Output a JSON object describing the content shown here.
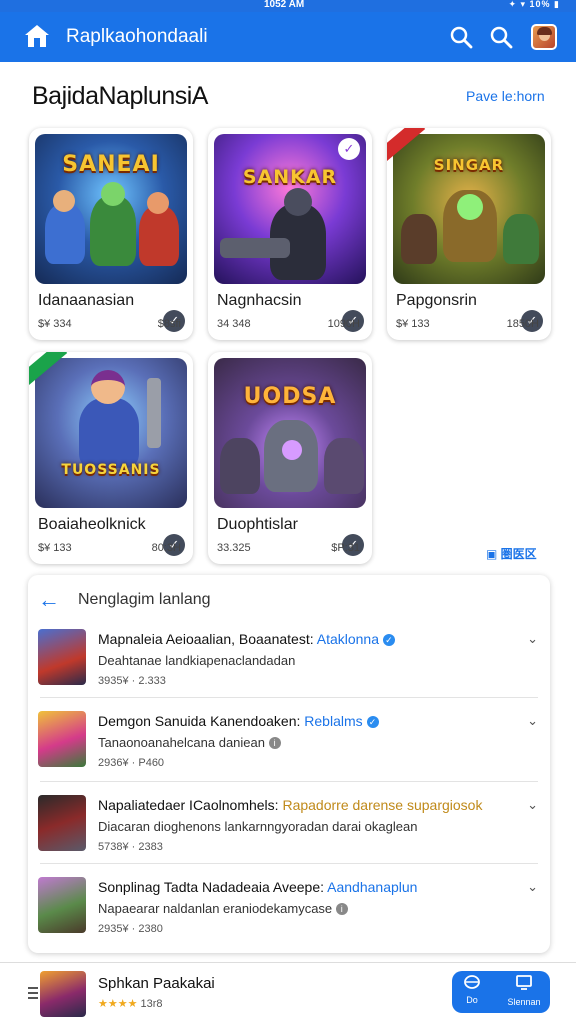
{
  "status_bar": {
    "time": "1052 AM",
    "icons": "✦ ▾ 10% ▮"
  },
  "app_bar": {
    "title": "Raplkaohondaali"
  },
  "featured": {
    "title": "BajidaNaplunsiA",
    "link": "Pave le:horn",
    "cards": [
      {
        "name": "Idanaanasian",
        "price": "$¥ 334",
        "size": "$8sfi",
        "logo": "SANEAI"
      },
      {
        "name": "Nagnhacsin",
        "price": "34 348",
        "size": "1090H",
        "logo": "SANKAR"
      },
      {
        "name": "Papgonsrin",
        "price": "$¥ 133",
        "size": "1850H",
        "logo": "SINGAR"
      },
      {
        "name": "Boaiaheolknick",
        "price": "$¥ 133",
        "size": "80:3H",
        "logo": "TUOSSANIS"
      },
      {
        "name": "Duophtislar",
        "price": "33.325",
        "size": "$P:31",
        "logo": "UODSA"
      }
    ],
    "view_more": "▣ 圏医区"
  },
  "list_panel": {
    "title": "Nenglagim lanlang",
    "items": [
      {
        "title": "Mapnaleia Aeioaalian, Boaanatest:",
        "tag": "Ataklonna",
        "desc": "Deahtanae landkiapenaclandadan",
        "meta": "3935¥ · 2.333"
      },
      {
        "title": "Demgon Sanuida Kanendoaken:",
        "tag": "Reblalms",
        "desc": "Tanaonoanahelcana daniean",
        "meta": "2936¥ · P460"
      },
      {
        "title": "Napaliatedaer ICaolnomhels:",
        "tag": "Rapadorre darense supargiosok",
        "desc": "Diacaran dioghenons lankarnngyoradan darai okaglean",
        "meta": "5738¥ · 2383"
      },
      {
        "title": "Sonplinag Tadta Nadadeaia Aveepe:",
        "tag": "Aandhanaplun",
        "desc": "Napaearar naldanlan eraniodekamycase",
        "meta": "2935¥ · 2380"
      }
    ]
  },
  "bottom_bar": {
    "title": "Sphkan Paakakai",
    "stars": "★★★★",
    "count": "13r8",
    "action1": "Do",
    "action2": "Slennan"
  }
}
